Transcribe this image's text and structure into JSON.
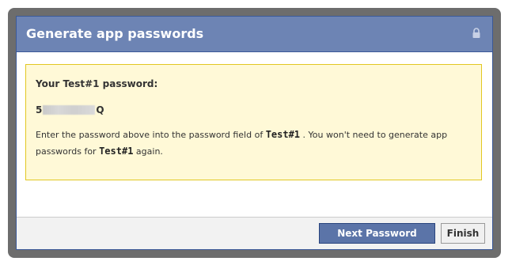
{
  "dialog": {
    "title": "Generate app passwords",
    "icon": "lock-icon"
  },
  "notice": {
    "heading": "Your Test#1 password:",
    "password_prefix": "5",
    "password_suffix": "Q",
    "instructions_part1": "Enter the password above into the password field of ",
    "app_name": "Test#1",
    "instructions_part2": " . You won't need to generate app passwords for ",
    "instructions_part3": " again."
  },
  "footer": {
    "next_label": "Next Password",
    "finish_label": "Finish"
  },
  "colors": {
    "header_bg": "#6d84b4",
    "border": "#3b5998",
    "notice_bg": "#fff9d7",
    "notice_border": "#e2c822",
    "primary_button": "#5b74a8"
  }
}
